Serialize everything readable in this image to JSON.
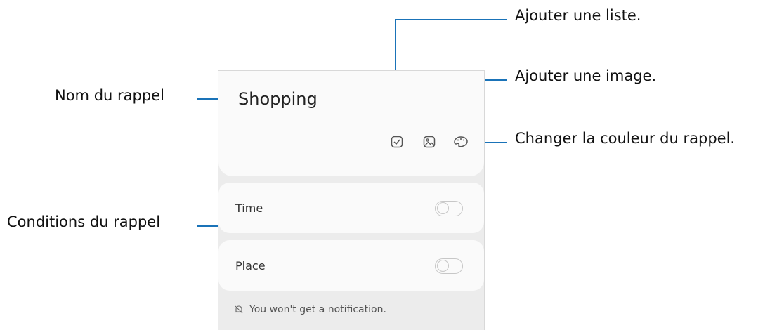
{
  "screen": {
    "note_title": "Shopping",
    "conditions": [
      {
        "label": "Time",
        "enabled": false
      },
      {
        "label": "Place",
        "enabled": false
      }
    ],
    "notice": "You won't get a notification."
  },
  "toolbar_icons": [
    "checklist-icon",
    "image-icon",
    "palette-icon"
  ],
  "callouts": {
    "add_list": "Ajouter une liste.",
    "add_image": "Ajouter une image.",
    "change_color": "Changer la couleur du rappel.",
    "reminder_name": "Nom du rappel",
    "reminder_conditions": "Conditions du rappel"
  },
  "colors": {
    "callout_line": "#1a73b8",
    "background": "#ffffff",
    "card": "#fafafa",
    "screen_bg": "#ececec"
  }
}
